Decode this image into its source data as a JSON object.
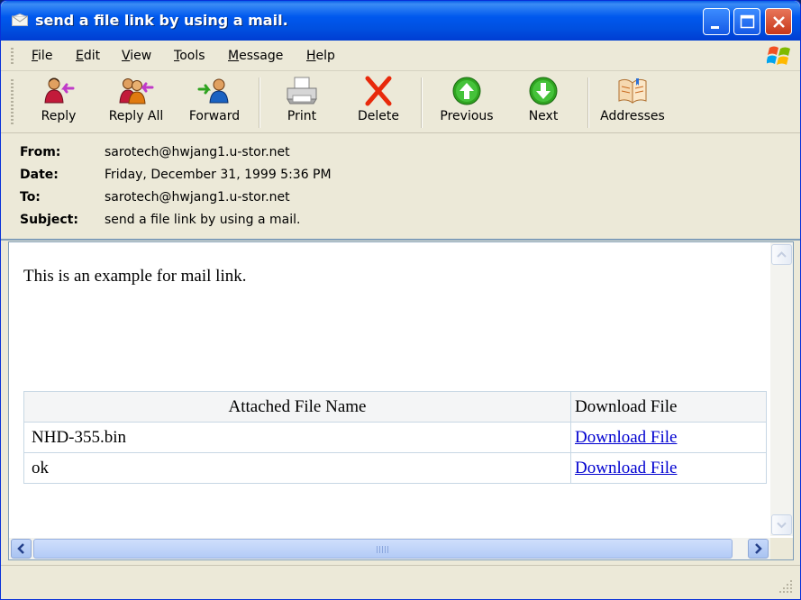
{
  "window": {
    "title": "send a file link by using a mail."
  },
  "menu": {
    "file": "File",
    "edit": "Edit",
    "view": "View",
    "tools": "Tools",
    "message": "Message",
    "help": "Help"
  },
  "toolbar": {
    "reply": "Reply",
    "reply_all": "Reply All",
    "forward": "Forward",
    "print": "Print",
    "delete": "Delete",
    "previous": "Previous",
    "next": "Next",
    "addresses": "Addresses"
  },
  "header": {
    "from_label": "From:",
    "from_value": "sarotech@hwjang1.u-stor.net",
    "date_label": "Date:",
    "date_value": "Friday, December 31, 1999 5:36 PM",
    "to_label": "To:",
    "to_value": "sarotech@hwjang1.u-stor.net",
    "subject_label": "Subject:",
    "subject_value": "send a file link by using a mail."
  },
  "message": {
    "body": "This is an example for mail link.",
    "table": {
      "col_name": "Attached File Name",
      "col_download": "Download File",
      "rows": [
        {
          "name": "NHD-355.bin",
          "link": "Download File"
        },
        {
          "name": "ok",
          "link": "Download File"
        }
      ]
    }
  },
  "status": {
    "text": ""
  },
  "colors": {
    "titlebar": "#0058ee",
    "chrome": "#ece9d8",
    "link": "#0000d0",
    "delete_icon": "#e8290b",
    "nav_arrow": "#2fa320"
  },
  "icons": {
    "title": "envelope-icon",
    "reply": "reply-icon",
    "reply_all": "reply-all-icon",
    "forward": "forward-icon",
    "print": "printer-icon",
    "delete": "delete-x-icon",
    "previous": "arrow-up-icon",
    "next": "arrow-down-icon",
    "addresses": "address-book-icon"
  }
}
